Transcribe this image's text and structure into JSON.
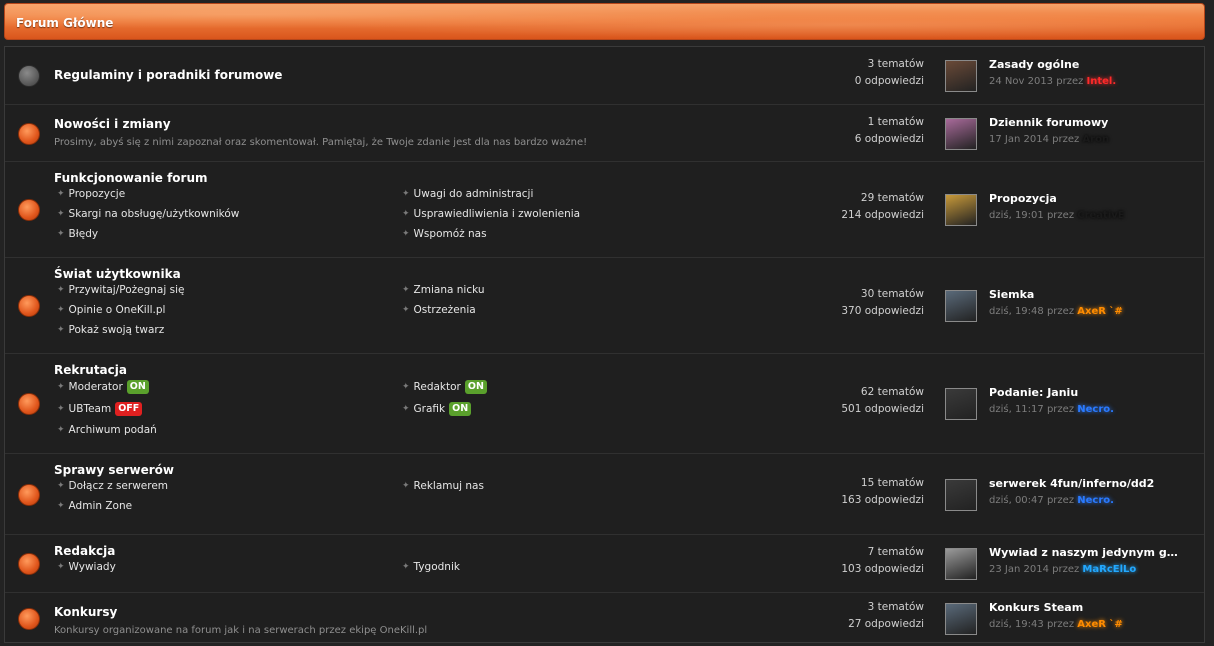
{
  "header": {
    "title": "Forum Główne"
  },
  "forums": [
    {
      "name": "Regulaminy i poradniki forumowe",
      "description": "",
      "read": true,
      "subforums_left": [],
      "subforums_right": [],
      "topics": "3 tematów",
      "replies": "0 odpowiedzi",
      "last": {
        "title": "Zasady ogólne",
        "date": "24 Nov 2013",
        "by": "przez",
        "user": "Intel.",
        "user_color": "#ff2a2a",
        "avatar": "#6a4a38"
      }
    },
    {
      "name": "Nowości i zmiany",
      "description": "Prosimy, abyś się z nimi zapoznał oraz skomentował. Pamiętaj, że Twoje zdanie jest dla nas bardzo ważne!",
      "read": false,
      "subforums_left": [],
      "subforums_right": [],
      "topics": "1 tematów",
      "replies": "6 odpowiedzi",
      "last": {
        "title": "Dziennik forumowy",
        "date": "17 Jan 2014",
        "by": "przez",
        "user": "Aron",
        "user_color": "#1a1a1a",
        "avatar": "#a86a9a"
      }
    },
    {
      "name": "Funkcjonowanie forum",
      "description": "",
      "read": false,
      "subforums_left": [
        {
          "label": "Propozycje"
        },
        {
          "label": "Skargi na obsługę/użytkowników"
        },
        {
          "label": "Błędy"
        }
      ],
      "subforums_right": [
        {
          "label": "Uwagi do administracji"
        },
        {
          "label": "Usprawiedliwienia i zwolenienia"
        },
        {
          "label": "Wspomóż nas"
        }
      ],
      "topics": "29 tematów",
      "replies": "214 odpowiedzi",
      "last": {
        "title": "Propozycja",
        "date": "dziś, 19:01",
        "by": "przez",
        "user": "CreativE",
        "user_color": "#1a1a1a",
        "avatar": "#c89a3a"
      }
    },
    {
      "name": "Świat użytkownika",
      "description": "",
      "read": false,
      "subforums_left": [
        {
          "label": "Przywitaj/Pożegnaj się"
        },
        {
          "label": "Opinie o OneKill.pl"
        },
        {
          "label": "Pokaż swoją twarz"
        }
      ],
      "subforums_right": [
        {
          "label": "Zmiana nicku"
        },
        {
          "label": "Ostrzeżenia"
        }
      ],
      "topics": "30 tematów",
      "replies": "370 odpowiedzi",
      "last": {
        "title": "Siemka",
        "date": "dziś, 19:48",
        "by": "przez",
        "user": "AxeR `#",
        "user_color": "#ff8c00",
        "avatar": "#5a6a7a"
      }
    },
    {
      "name": "Rekrutacja",
      "description": "",
      "read": false,
      "subforums_left": [
        {
          "label": "Moderator",
          "badge": "ON",
          "badge_color": "#5aa02c"
        },
        {
          "label": "UBTeam",
          "badge": "OFF",
          "badge_color": "#e02020"
        },
        {
          "label": "Archiwum podań"
        }
      ],
      "subforums_right": [
        {
          "label": "Redaktor",
          "badge": "ON",
          "badge_color": "#5aa02c"
        },
        {
          "label": "Grafik",
          "badge": "ON",
          "badge_color": "#5aa02c"
        }
      ],
      "topics": "62 tematów",
      "replies": "501 odpowiedzi",
      "last": {
        "title": "Podanie: Janiu",
        "date": "dziś, 11:17",
        "by": "przez",
        "user": "Necro.",
        "user_color": "#2a7aff",
        "avatar": "#3a3a3a"
      }
    },
    {
      "name": "Sprawy serwerów",
      "description": "",
      "read": false,
      "subforums_left": [
        {
          "label": "Dołącz z serwerem"
        },
        {
          "label": "Admin Zone"
        }
      ],
      "subforums_right": [
        {
          "label": "Reklamuj nas"
        }
      ],
      "topics": "15 tematów",
      "replies": "163 odpowiedzi",
      "last": {
        "title": "serwerek 4fun/inferno/dd2",
        "date": "dziś, 00:47",
        "by": "przez",
        "user": "Necro.",
        "user_color": "#2a7aff",
        "avatar": "#3a3a3a"
      }
    },
    {
      "name": "Redakcja",
      "description": "",
      "read": false,
      "subforums_left": [
        {
          "label": "Wywiady"
        }
      ],
      "subforums_right": [
        {
          "label": "Tygodnik"
        }
      ],
      "topics": "7 tematów",
      "replies": "103 odpowiedzi",
      "last": {
        "title": "Wywiad z naszym jedynym gra...",
        "date": "23 Jan 2014",
        "by": "przez",
        "user": "MaRcElLo",
        "user_color": "#22a8ff",
        "avatar": "#9a9a9a"
      }
    },
    {
      "name": "Konkursy",
      "description": "Konkursy organizowane na forum jak i na serwerach przez ekipę OneKill.pl",
      "read": false,
      "subforums_left": [],
      "subforums_right": [],
      "topics": "3 tematów",
      "replies": "27 odpowiedzi",
      "last": {
        "title": "Konkurs Steam",
        "date": "dziś, 19:43",
        "by": "przez",
        "user": "AxeR `#",
        "user_color": "#ff8c00",
        "avatar": "#5a6a7a"
      }
    }
  ]
}
